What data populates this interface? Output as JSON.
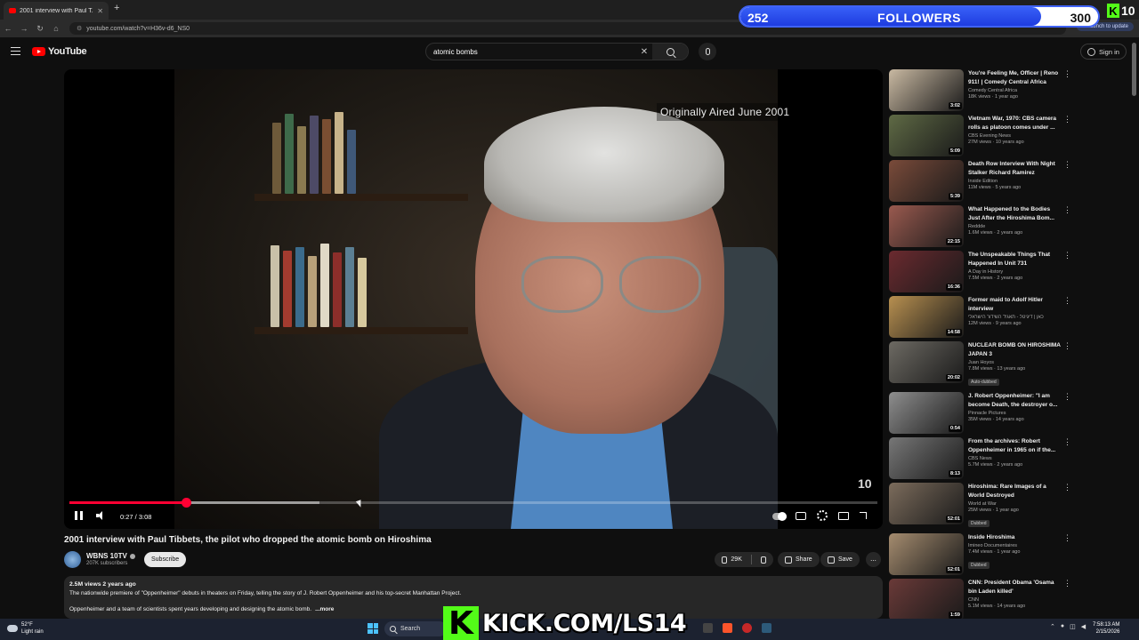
{
  "browser": {
    "tab_title": "2001 interview with Paul T...",
    "url": "youtube.com/watch?v=H36v-d6_NS0",
    "update_label": "Relaunch to update"
  },
  "stream_overlay": {
    "followers_current": "252",
    "followers_label": "FOLLOWERS",
    "followers_goal": "300",
    "followers_progress": 0.84,
    "top_badge": "10",
    "kick_url": "KICK.COM/LS14",
    "kick_color": "#53fc18"
  },
  "youtube": {
    "logo_text": "YouTube",
    "search_value": "atomic bombs",
    "signin_label": "Sign in",
    "brand_color": "#ff0000"
  },
  "player": {
    "aired_caption": "Originally Aired  June 2001",
    "station_logo": "10",
    "time": "0:27 / 3:08",
    "played_fraction": 0.144,
    "buffered_fraction": 0.309,
    "accent_color": "#ff0033"
  },
  "video": {
    "title": "2001 interview with Paul Tibbets, the pilot who dropped the atomic bomb on Hiroshima",
    "channel": "WBNS 10TV",
    "subscribers": "207K subscribers",
    "subscribe_label": "Subscribe",
    "likes": "29K",
    "share_label": "Share",
    "save_label": "Save",
    "more_label": "...",
    "desc_meta": "2.5M views  2 years ago",
    "desc_line1": "The nationwide premiere of \"Oppenheimer\" debuts in theaters on Friday, telling the story of J. Robert Oppenheimer and his top-secret Manhattan Project.",
    "desc_line2": "Oppenheimer and a team of scientists spent years developing and designing the atomic bomb.",
    "desc_more": "...more"
  },
  "recommendations": [
    {
      "title": "You're Feeling Me, Officer | Reno 911! | Comedy Central Africa",
      "channel": "Comedy Central Africa",
      "meta": "18K views · 1 year ago",
      "duration": "3:02",
      "badge": "",
      "thumb_color": "#c9b9a2"
    },
    {
      "title": "Vietnam War, 1970: CBS camera rolls as platoon comes under ...",
      "channel": "CBS Evening News",
      "meta": "27M views · 10 years ago",
      "duration": "5:09",
      "badge": "",
      "thumb_color": "#5f6a45"
    },
    {
      "title": "Death Row Interview With Night Stalker Richard Ramirez",
      "channel": "Inside Edition",
      "meta": "11M views · 5 years ago",
      "duration": "5:39",
      "badge": "",
      "thumb_color": "#7a4b3a"
    },
    {
      "title": "What Happened to the Bodies Just After the Hiroshima Bom...",
      "channel": "Reddde",
      "meta": "1.6M views · 2 years ago",
      "duration": "22:15",
      "badge": "",
      "thumb_color": "#9a5a4f"
    },
    {
      "title": "The Unspeakable Things That Happened In Unit 731",
      "channel": "A Day in History",
      "meta": "7.5M views · 2 years ago",
      "duration": "16:36",
      "badge": "",
      "thumb_color": "#6b2a2f"
    },
    {
      "title": "Former maid to Adolf Hitler interview",
      "channel": "כאן | דיגיטל - תאגיד השידור הישראלי",
      "meta": "12M views · 9 years ago",
      "duration": "14:58",
      "badge": "",
      "thumb_color": "#b89050"
    },
    {
      "title": "NUCLEAR BOMB ON HIROSHIMA JAPAN 3",
      "channel": "Juan Hoyos",
      "meta": "7.8M views · 13 years ago",
      "duration": "20:02",
      "badge": "Auto-dubbed",
      "thumb_color": "#6d6a63"
    },
    {
      "title": "J. Robert Oppenheimer: \"I am become Death, the destroyer o...",
      "channel": "Pinnacle Pictures",
      "meta": "35M views · 14 years ago",
      "duration": "0:54",
      "badge": "",
      "thumb_color": "#8e8e8e"
    },
    {
      "title": "From the archives: Robert Oppenheimer in 1965 on if the...",
      "channel": "CBS News",
      "meta": "5.7M views · 2 years ago",
      "duration": "8:13",
      "badge": "",
      "thumb_color": "#777777"
    },
    {
      "title": "Hiroshima: Rare Images of a World Destroyed",
      "channel": "World at War",
      "meta": "25M views · 1 year ago",
      "duration": "52:01",
      "badge": "Dubbed",
      "thumb_color": "#7c6c5c"
    },
    {
      "title": "Inside Hiroshima",
      "channel": "Imineo Documentaires",
      "meta": "7.4M views · 1 year ago",
      "duration": "52:01",
      "badge": "Dubbed",
      "thumb_color": "#a58c6f"
    },
    {
      "title": "CNN: President Obama 'Osama bin Laden killed'",
      "channel": "CNN",
      "meta": "5.1M views · 14 years ago",
      "duration": "1:59",
      "badge": "",
      "thumb_color": "#6a3a38"
    }
  ],
  "taskbar": {
    "temp": "52°F",
    "weather": "Light rain",
    "search_label": "Search",
    "time": "7:58:13 AM",
    "date": "2/15/2026"
  }
}
